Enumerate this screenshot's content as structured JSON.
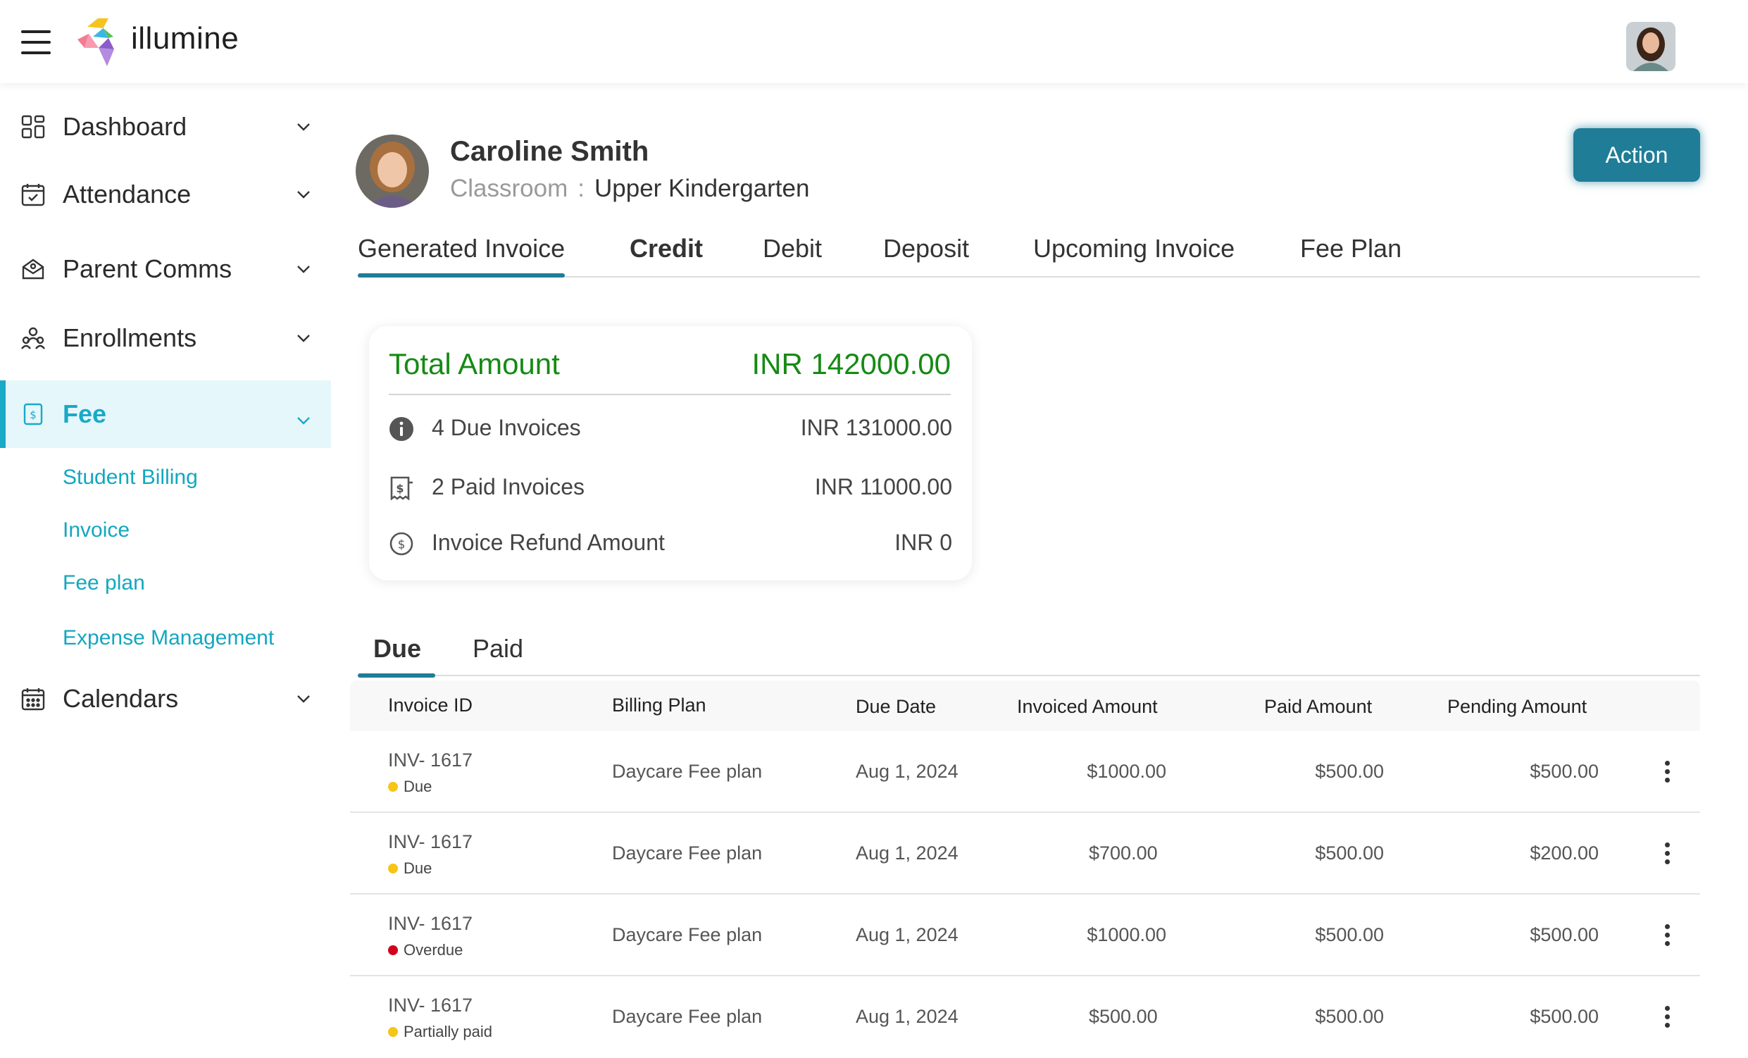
{
  "header": {
    "app_name": "illumine",
    "menu_icon": "hamburger-icon",
    "logo_icon": "illumine-logo-icon",
    "user_avatar": "user-avatar"
  },
  "sidebar": {
    "items": [
      {
        "label": "Dashboard",
        "icon": "dashboard-icon"
      },
      {
        "label": "Attendance",
        "icon": "calendar-check-icon"
      },
      {
        "label": "Parent Comms",
        "icon": "message-icon"
      },
      {
        "label": "Enrollments",
        "icon": "people-icon"
      },
      {
        "label": "Fee",
        "icon": "dollar-icon",
        "active": true
      },
      {
        "label": "Calendars",
        "icon": "calendar-icon"
      }
    ],
    "fee_subitems": [
      "Student Billing",
      "Invoice",
      "Fee plan",
      "Expense Management"
    ],
    "accent_color": "#1aa9c6"
  },
  "profile": {
    "name": "Caroline Smith",
    "classroom_label": "Classroom",
    "classroom_sep": ":",
    "classroom_value": "Upper Kindergarten"
  },
  "action_button": {
    "label": "Action",
    "color": "#1f7d97"
  },
  "main_tabs": [
    "Generated Invoice",
    "Credit",
    "Debit",
    "Deposit",
    "Upcoming Invoice",
    "Fee Plan"
  ],
  "summary": {
    "title": "Total Amount",
    "total": "INR 142000.00",
    "total_color": "#158a14",
    "rows": [
      {
        "icon": "info-icon",
        "label": "4 Due Invoices",
        "value": "INR 131000.00"
      },
      {
        "icon": "receipt-icon",
        "label": "2 Paid Invoices",
        "value": "INR 11000.00"
      },
      {
        "icon": "dollar-circle-icon",
        "label": "Invoice Refund Amount",
        "value": "INR 0"
      }
    ]
  },
  "sub_tabs": [
    "Due",
    "Paid"
  ],
  "table": {
    "columns": [
      "Invoice ID",
      "Billing Plan",
      "Due Date",
      "Invoiced Amount",
      "Paid Amount",
      "Pending Amount"
    ],
    "rows": [
      {
        "id": "INV- 1617",
        "status": "Due",
        "status_color": "#f5c518",
        "plan": "Daycare Fee plan",
        "due_date": "Aug 1, 2024",
        "invoiced": "$1000.00",
        "paid": "$500.00",
        "pending": "$500.00"
      },
      {
        "id": "INV- 1617",
        "status": "Due",
        "status_color": "#f5c518",
        "plan": "Daycare Fee plan",
        "due_date": "Aug 1, 2024",
        "invoiced": "$700.00",
        "paid": "$500.00",
        "pending": "$200.00"
      },
      {
        "id": "INV- 1617",
        "status": "Overdue",
        "status_color": "#d0021b",
        "plan": "Daycare Fee plan",
        "due_date": "Aug 1, 2024",
        "invoiced": "$1000.00",
        "paid": "$500.00",
        "pending": "$500.00"
      },
      {
        "id": "INV- 1617",
        "status": "Partially paid",
        "status_color": "#f5c518",
        "plan": "Daycare Fee plan",
        "due_date": "Aug 1, 2024",
        "invoiced": "$500.00",
        "paid": "$500.00",
        "pending": "$500.00"
      }
    ]
  }
}
